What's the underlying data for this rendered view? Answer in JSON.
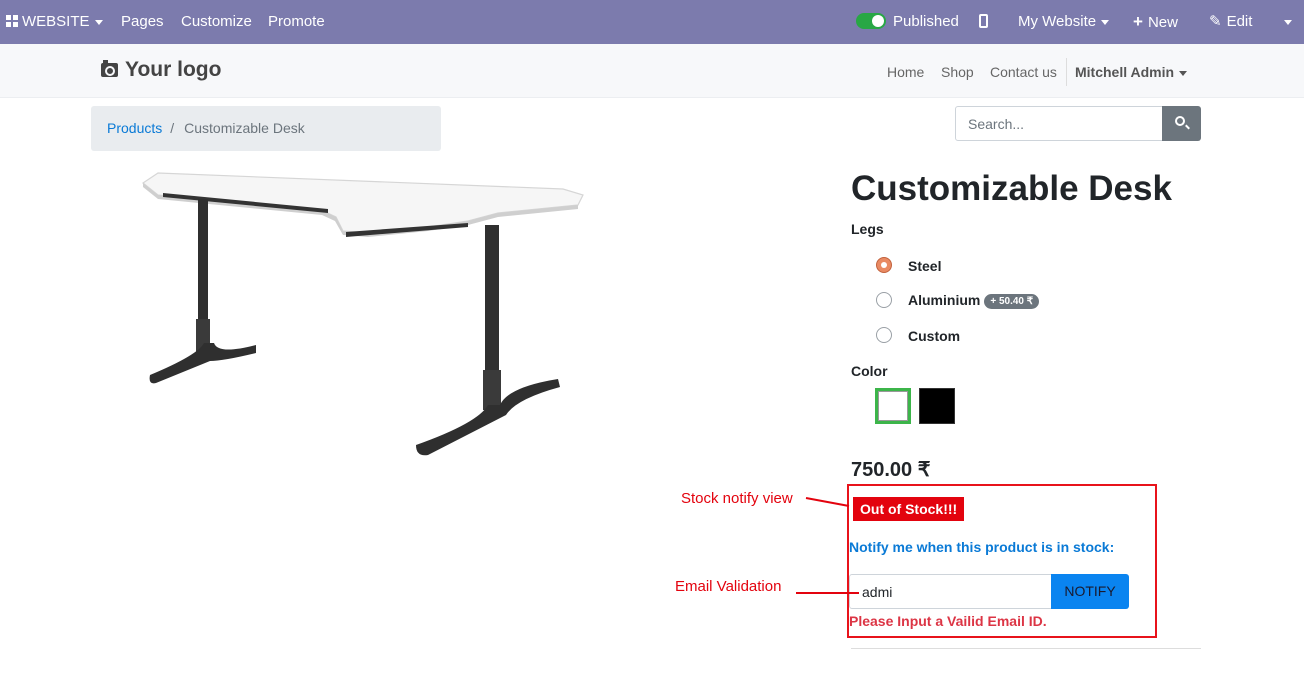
{
  "adminbar": {
    "website_label": "WEBSITE",
    "menu": [
      "Pages",
      "Customize",
      "Promote"
    ],
    "published_label": "Published",
    "my_website_label": "My Website",
    "new_label": "New",
    "edit_label": "Edit"
  },
  "header": {
    "logo_text": "Your logo",
    "nav": [
      "Home",
      "Shop",
      "Contact us"
    ],
    "user": "Mitchell Admin"
  },
  "breadcrumb": {
    "parent": "Products",
    "separator": "/",
    "current": "Customizable Desk"
  },
  "search": {
    "placeholder": "Search..."
  },
  "product": {
    "title": "Customizable Desk",
    "attributes": {
      "legs_label": "Legs",
      "legs_options": [
        {
          "label": "Steel",
          "selected": true,
          "extra": ""
        },
        {
          "label": "Aluminium",
          "selected": false,
          "extra": "+ 50.40 ₹"
        },
        {
          "label": "Custom",
          "selected": false,
          "extra": ""
        }
      ],
      "color_label": "Color",
      "colors": [
        {
          "value": "#ffffff",
          "selected": true
        },
        {
          "value": "#000000",
          "selected": false
        }
      ]
    },
    "price": "750.00 ₹"
  },
  "stock_notify": {
    "badge": "Out of Stock!!!",
    "prompt": "Notify me when this product is in stock:",
    "email_value": "admi",
    "button_label": "NOTIFY",
    "error": "Please Input a Vailid Email ID."
  },
  "annotations": {
    "stock_notify_view": "Stock notify view",
    "email_validation": "Email Validation"
  },
  "colors": {
    "adminbar": "#7c7bad",
    "accent_red": "#e3030e",
    "link_blue": "#0a7ad6",
    "notify_button": "#0a84f0"
  }
}
